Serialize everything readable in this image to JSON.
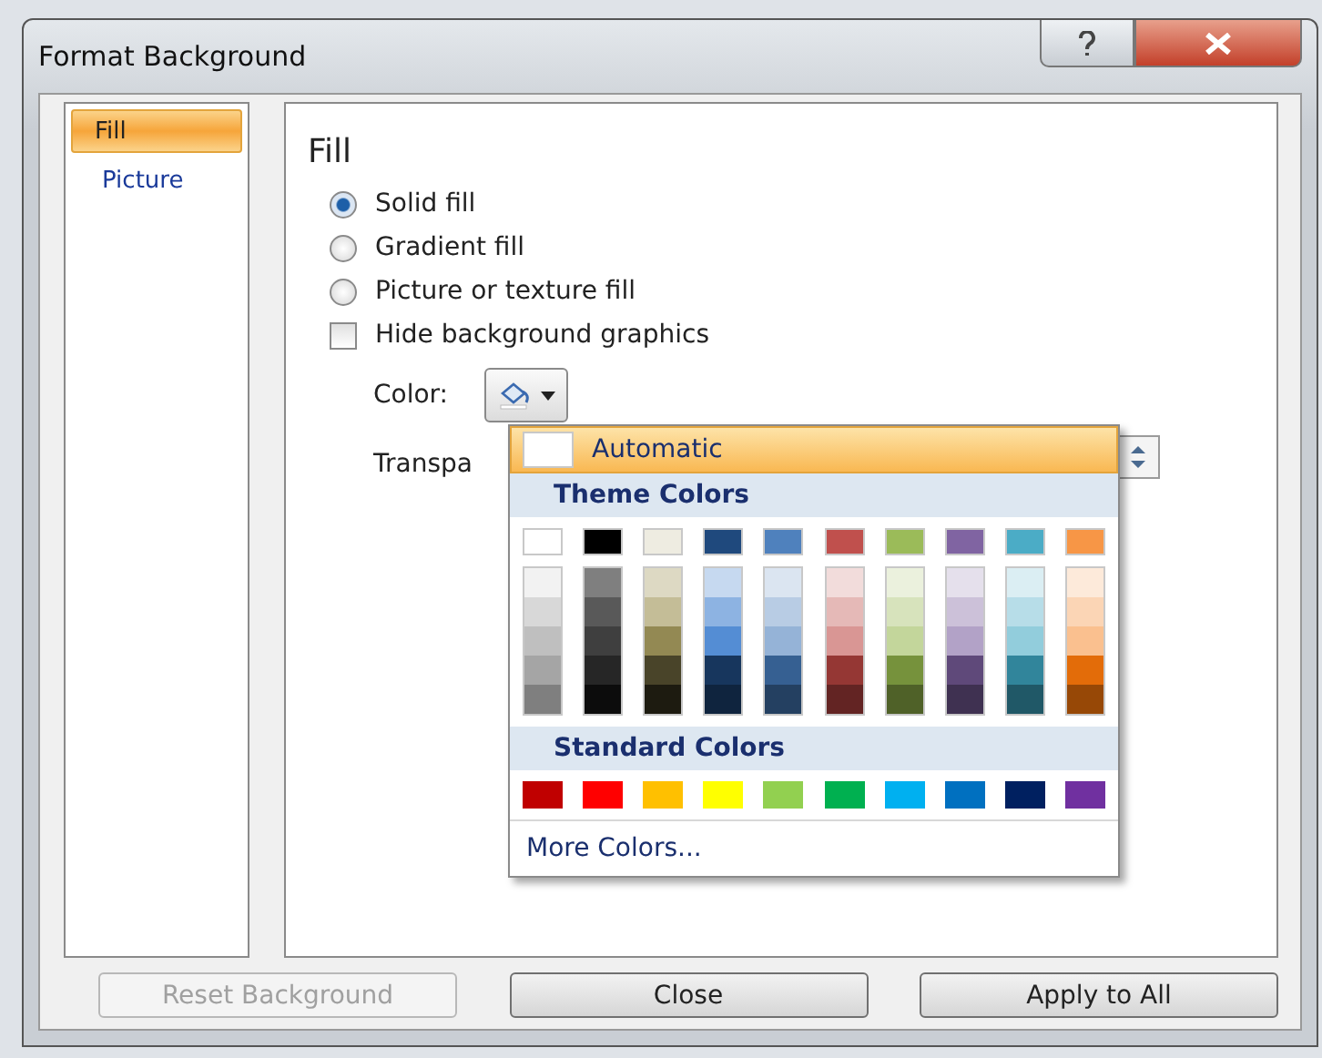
{
  "window": {
    "title": "Format Background"
  },
  "sidebar": {
    "items": [
      {
        "label": "Fill",
        "selected": true
      },
      {
        "label": "Picture",
        "selected": false
      }
    ]
  },
  "fill": {
    "heading": "Fill",
    "options": [
      {
        "kind": "radio",
        "label": "Solid fill",
        "selected": true
      },
      {
        "kind": "radio",
        "label": "Gradient fill",
        "selected": false
      },
      {
        "kind": "radio",
        "label": "Picture or texture fill",
        "selected": false
      },
      {
        "kind": "checkbox",
        "label": "Hide background graphics",
        "checked": false
      }
    ],
    "color_label": "Color:",
    "transparency_label": "Transpa"
  },
  "color_menu": {
    "automatic": {
      "label": "Automatic",
      "selected": true
    },
    "theme_heading": "Theme Colors",
    "theme_colors": [
      {
        "color": "#ffffff",
        "shades": [
          {
            "color": "#f2f2f2"
          },
          {
            "color": "#d8d8d8"
          },
          {
            "color": "#bfbfbf"
          },
          {
            "color": "#a5a5a5"
          },
          {
            "color": "#7f7f7f"
          }
        ]
      },
      {
        "color": "#000000",
        "shades": [
          {
            "color": "#7f7f7f"
          },
          {
            "color": "#595959"
          },
          {
            "color": "#3f3f3f"
          },
          {
            "color": "#262626"
          },
          {
            "color": "#0c0c0c"
          }
        ]
      },
      {
        "color": "#eeece1",
        "shades": [
          {
            "color": "#ddd9c3"
          },
          {
            "color": "#c4bd97"
          },
          {
            "color": "#938953"
          },
          {
            "color": "#494429"
          },
          {
            "color": "#1d1b10"
          }
        ]
      },
      {
        "color": "#1f497d",
        "shades": [
          {
            "color": "#c6d9f0"
          },
          {
            "color": "#8db3e2"
          },
          {
            "color": "#548dd4"
          },
          {
            "color": "#17365d"
          },
          {
            "color": "#0f243e"
          }
        ]
      },
      {
        "color": "#4f81bd",
        "shades": [
          {
            "color": "#dbe5f1"
          },
          {
            "color": "#b8cce4"
          },
          {
            "color": "#95b3d7"
          },
          {
            "color": "#366092"
          },
          {
            "color": "#244061"
          }
        ]
      },
      {
        "color": "#c0504d",
        "shades": [
          {
            "color": "#f2dcdb"
          },
          {
            "color": "#e5b9b7"
          },
          {
            "color": "#d99694"
          },
          {
            "color": "#953734"
          },
          {
            "color": "#632423"
          }
        ]
      },
      {
        "color": "#9bbb59",
        "shades": [
          {
            "color": "#ebf1dd"
          },
          {
            "color": "#d7e3bc"
          },
          {
            "color": "#c3d69b"
          },
          {
            "color": "#76923c"
          },
          {
            "color": "#4f6128"
          }
        ]
      },
      {
        "color": "#8064a2",
        "shades": [
          {
            "color": "#e5e0ec"
          },
          {
            "color": "#ccc1d9"
          },
          {
            "color": "#b2a2c7"
          },
          {
            "color": "#5f497a"
          },
          {
            "color": "#3f3151"
          }
        ]
      },
      {
        "color": "#4bacc6",
        "shades": [
          {
            "color": "#dbeef3"
          },
          {
            "color": "#b7dde8"
          },
          {
            "color": "#92cddc"
          },
          {
            "color": "#31859b"
          },
          {
            "color": "#205867"
          }
        ]
      },
      {
        "color": "#f79646",
        "shades": [
          {
            "color": "#fdeada"
          },
          {
            "color": "#fbd5b5"
          },
          {
            "color": "#fac08f"
          },
          {
            "color": "#e36c09"
          },
          {
            "color": "#974806"
          }
        ]
      }
    ],
    "standard_heading": "Standard Colors",
    "standard_colors": [
      {
        "color": "#c00000"
      },
      {
        "color": "#ff0000"
      },
      {
        "color": "#ffc000"
      },
      {
        "color": "#ffff00"
      },
      {
        "color": "#92d050"
      },
      {
        "color": "#00b050"
      },
      {
        "color": "#00b0f0"
      },
      {
        "color": "#0070c0"
      },
      {
        "color": "#002060"
      },
      {
        "color": "#7030a0"
      }
    ],
    "more_colors": "More Colors..."
  },
  "buttons": [
    {
      "label": "Reset Background",
      "disabled": true
    },
    {
      "label": "Close",
      "disabled": false
    },
    {
      "label": "Apply to All",
      "disabled": false
    }
  ]
}
